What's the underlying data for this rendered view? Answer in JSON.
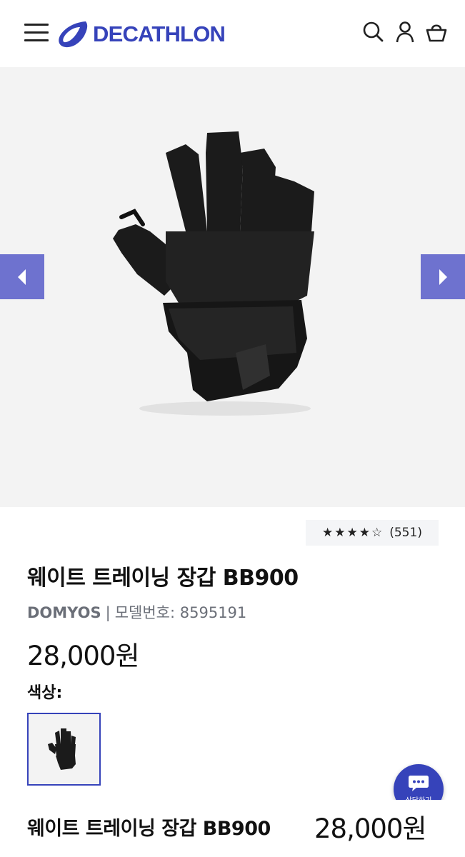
{
  "header": {
    "brand": "DECATHLON",
    "brand_color": "#3643ba",
    "icons": [
      "menu-icon",
      "search-icon",
      "user-icon",
      "cart-icon"
    ]
  },
  "gallery": {
    "image": "fingerless-gym-glove-photo",
    "prev_icon": "chevron-left-icon",
    "next_icon": "chevron-right-icon",
    "arrow_color": "#6e72cf"
  },
  "product": {
    "rating_stars": "★★★★☆",
    "rating": 4,
    "rating_max": 5,
    "review_count": "(551)",
    "title": "웨이트 트레이닝 장갑 BB900",
    "brand": "DOMYOS",
    "separator": "|",
    "model_label": "모델번호:",
    "model_number": "8595191",
    "price": "28,000원",
    "color_label": "색상:"
  },
  "chat": {
    "label": "상담하기",
    "icon": "chat-bubble-icon"
  },
  "sticky": {
    "title": "웨이트 트레이닝 장갑 BB900",
    "price": "28,000원"
  }
}
